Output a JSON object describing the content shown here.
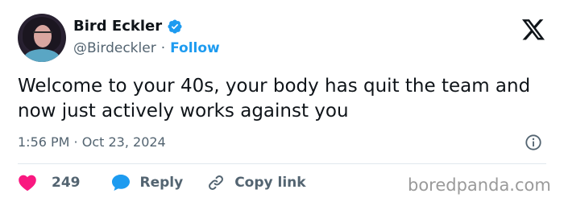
{
  "author": {
    "display_name": "Bird Eckler",
    "handle": "@Birdeckler",
    "separator": "·",
    "follow_label": "Follow",
    "verified": true
  },
  "tweet": {
    "text": "Welcome to your 40s, your body has quit the team and now just actively works against you",
    "timestamp": "1:56 PM · Oct 23, 2024"
  },
  "actions": {
    "like_count": "249",
    "reply_label": "Reply",
    "copy_link_label": "Copy link"
  },
  "icons": {
    "verified": "verified-badge-icon",
    "platform": "x-logo-icon",
    "info": "info-icon",
    "like": "heart-icon",
    "reply": "speech-bubble-icon",
    "copy": "link-icon"
  },
  "colors": {
    "accent": "#1d9bf0",
    "like": "#f91880",
    "text": "#0f1419",
    "secondary": "#536471"
  },
  "watermark": "boredpanda.com"
}
